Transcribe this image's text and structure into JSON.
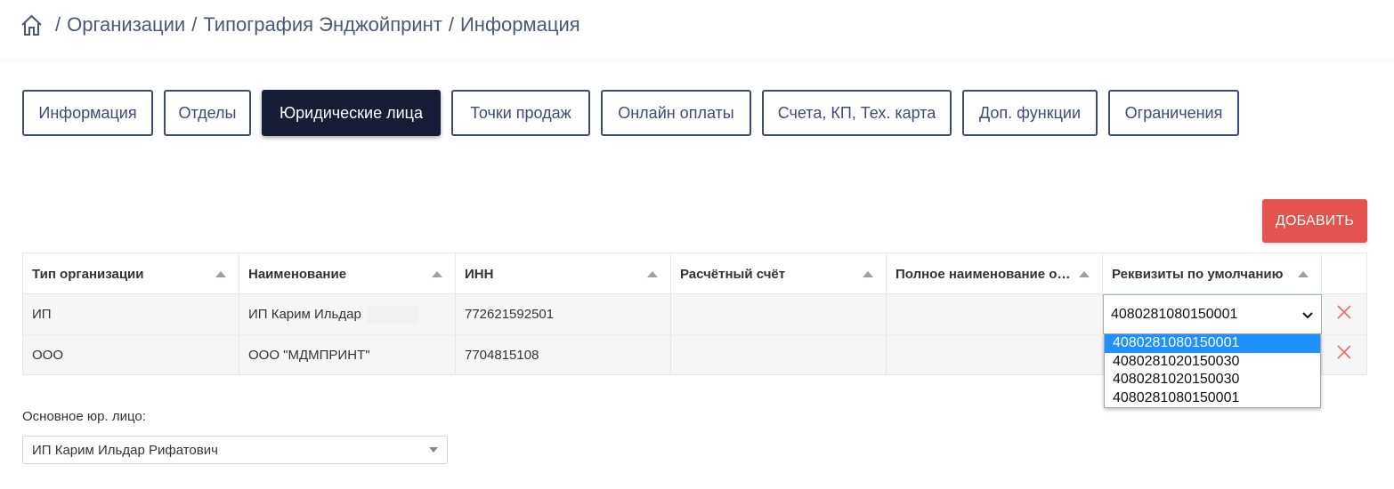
{
  "breadcrumb": {
    "home_icon": "home-icon",
    "separator": "/",
    "items": [
      "Организации",
      "Типография Энджойпринт",
      "Информация"
    ]
  },
  "tabs": [
    {
      "label": "Информация",
      "active": false
    },
    {
      "label": "Отделы",
      "active": false
    },
    {
      "label": "Юридические лица",
      "active": true
    },
    {
      "label": "Точки продаж",
      "active": false
    },
    {
      "label": "Онлайн оплаты",
      "active": false
    },
    {
      "label": "Счета, КП, Тех. карта",
      "active": false
    },
    {
      "label": "Доп. функции",
      "active": false
    },
    {
      "label": "Ограничения",
      "active": false
    }
  ],
  "add_button": {
    "label": "ДОБАВИТЬ",
    "color": "#e5534e"
  },
  "grid": {
    "columns": [
      {
        "label": "Тип организации",
        "sort_icon": "sort-asc-icon"
      },
      {
        "label": "Наименование",
        "sort_icon": "sort-asc-icon"
      },
      {
        "label": "ИНН",
        "sort_icon": "sort-asc-icon"
      },
      {
        "label": "Расчётный счёт",
        "sort_icon": "sort-asc-icon"
      },
      {
        "label": "Полное наименование организации",
        "sort_icon": "sort-asc-icon"
      },
      {
        "label": "Реквизиты по умолчанию",
        "sort_icon": "sort-asc-icon"
      },
      {
        "label": ""
      }
    ],
    "rows": [
      {
        "type": "ИП",
        "name": "ИП Карим Ильдар",
        "inn": "772621592501",
        "account": "",
        "full_name": "",
        "default_requisites": "4080281080150001",
        "delete_icon": "close-icon"
      },
      {
        "type": "ООО",
        "name": "ООО \"МДМПРИНТ\"",
        "inn": "7704815108",
        "account": "",
        "full_name": "",
        "default_requisites": "",
        "delete_icon": "close-icon"
      }
    ]
  },
  "requisites_dropdown": {
    "selected": "4080281080150001",
    "options": [
      "4080281080150001",
      "4080281020150030",
      "4080281020150030",
      "4080281080150001"
    ]
  },
  "main_entity": {
    "label": "Основное юр. лицо:",
    "value": "ИП Карим Ильдар Рифатович"
  },
  "colors": {
    "accent_dark": "#171c37",
    "tab_border": "#3e4b73",
    "danger": "#e5534e",
    "highlight": "#1e90ff"
  }
}
